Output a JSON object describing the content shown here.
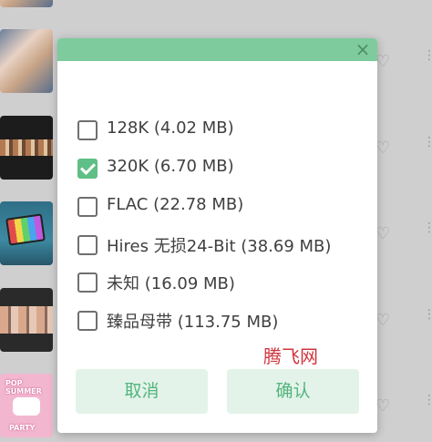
{
  "dialog": {
    "options": [
      {
        "label": "128K (4.02 MB)",
        "checked": false
      },
      {
        "label": "320K (6.70 MB)",
        "checked": true
      },
      {
        "label": "FLAC (22.78 MB)",
        "checked": false
      },
      {
        "label": "Hires 无损24-Bit (38.69 MB)",
        "checked": false
      },
      {
        "label": "未知 (16.09 MB)",
        "checked": false
      },
      {
        "label": "臻品母带 (113.75 MB)",
        "checked": false
      }
    ],
    "watermark": "腾飞网",
    "cancel_label": "取消",
    "confirm_label": "确认",
    "close_icon": "close-icon"
  },
  "background": {
    "thumb_texts": [
      "POP SUMMER",
      "PARTY"
    ],
    "icons": [
      "heart-icon",
      "more-vert-icon"
    ]
  },
  "colors": {
    "accent": "#7ecb9e",
    "checked": "#5fbf86",
    "button_bg": "#e3f3e9",
    "button_text": "#52b57d",
    "watermark": "#d0343c"
  }
}
